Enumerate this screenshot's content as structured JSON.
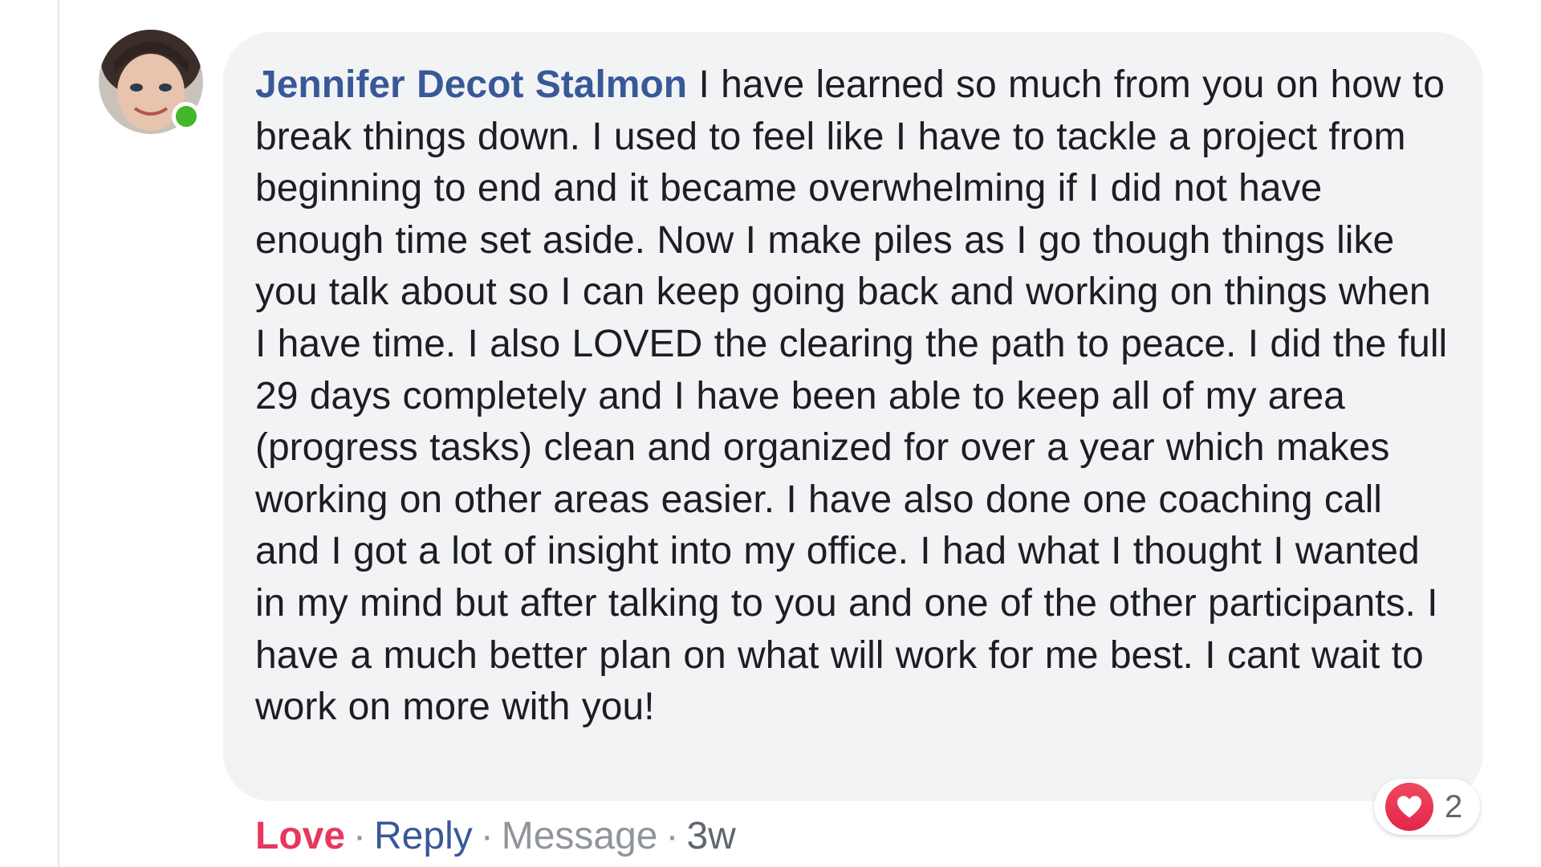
{
  "comment": {
    "author": "Jennifer Decot Stalmon",
    "text": " I have learned so much from you on how to break things down. I used to feel like I have to tackle a project from beginning to end and it became overwhelming if I did not have enough time set aside. Now I make piles as I go though things like you talk about so I can keep going back and working on things when I have time. I also LOVED the clearing the path to peace. I did the full 29 days completely and I have been able to keep all of my area (progress tasks) clean and organized for over a year which makes working on other areas easier. I have also done one coaching call and I got a lot of insight into my office. I had what I thought I wanted in my mind but after talking to you and one of the other participants. I have a much better plan on what will work for me best. I cant wait to work on more with you!",
    "online": true
  },
  "reactions": {
    "icon": "heart-icon",
    "count": "2"
  },
  "actions": {
    "love_label": "Love",
    "reply_label": "Reply",
    "message_label": "Message",
    "separator": "·",
    "time": "3w"
  },
  "colors": {
    "author": "#385898",
    "love": "#e9375c",
    "bubble": "#f2f3f5",
    "online": "#42b72a"
  }
}
